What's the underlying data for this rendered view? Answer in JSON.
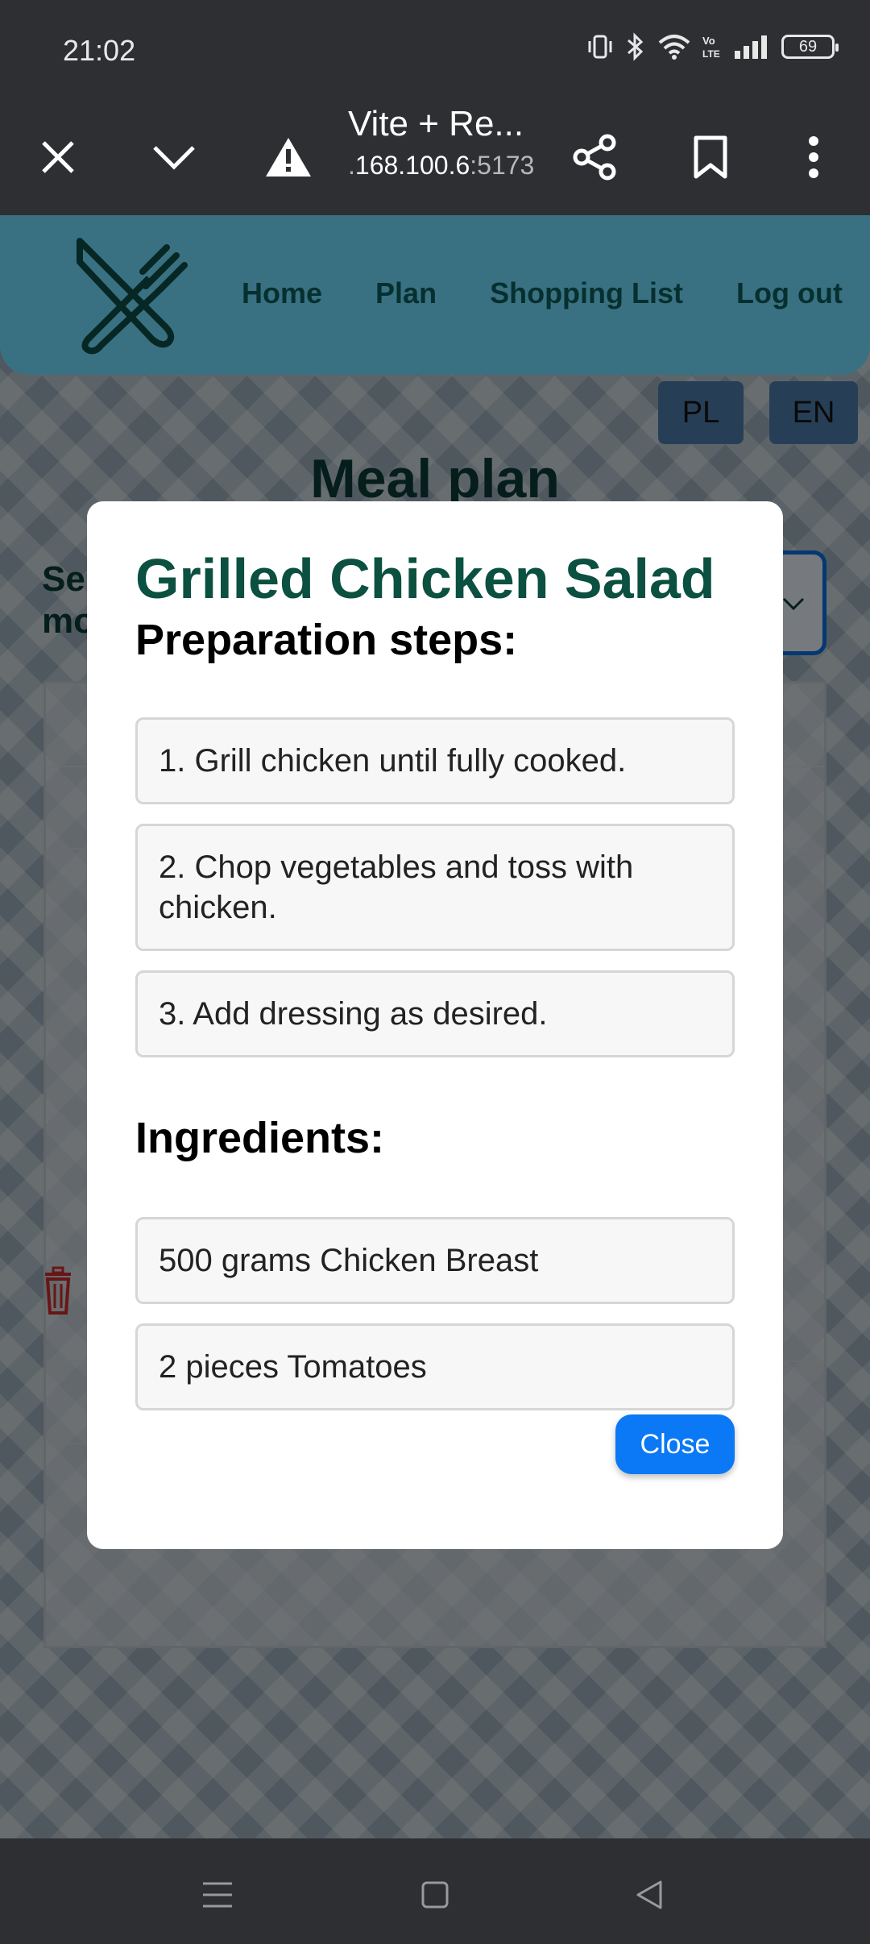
{
  "status_bar": {
    "time": "21:02",
    "battery": "69",
    "icons": [
      "vibrate-icon",
      "bluetooth-icon",
      "wifi-icon",
      "volte-icon",
      "signal-icon",
      "battery-icon"
    ]
  },
  "browser": {
    "page_title": "Vite + Re...",
    "url_prefix": ".",
    "url_host": "168.100.6",
    "url_port": ":5173",
    "icons": [
      "close-icon",
      "chevron-down-icon",
      "warning-icon",
      "share-icon",
      "bookmark-icon",
      "more-vertical-icon"
    ]
  },
  "app": {
    "nav": {
      "home": "Home",
      "plan": "Plan",
      "shopping_list": "Shopping List",
      "logout": "Log out"
    },
    "lang": {
      "pl": "PL",
      "en": "EN"
    },
    "page_title": "Meal plan",
    "select_label": "Se mo",
    "table_dash_1": "-",
    "table_dash_2": "-"
  },
  "modal": {
    "title": "Grilled Chicken Salad",
    "steps_heading": "Preparation steps:",
    "steps": [
      "1. Grill chicken until fully cooked.",
      "2. Chop vegetables and toss with chicken.",
      "3. Add dressing as desired."
    ],
    "ingredients_heading": "Ingredients:",
    "ingredients": [
      "500 grams Chicken Breast",
      "2 pieces Tomatoes"
    ],
    "close_label": "Close"
  },
  "colors": {
    "navbar": "#6dd6f6",
    "nav_text": "#0c5c59",
    "modal_title": "#0b5040",
    "close_button": "#0b78f5",
    "lang_button": "#4a77a3"
  }
}
